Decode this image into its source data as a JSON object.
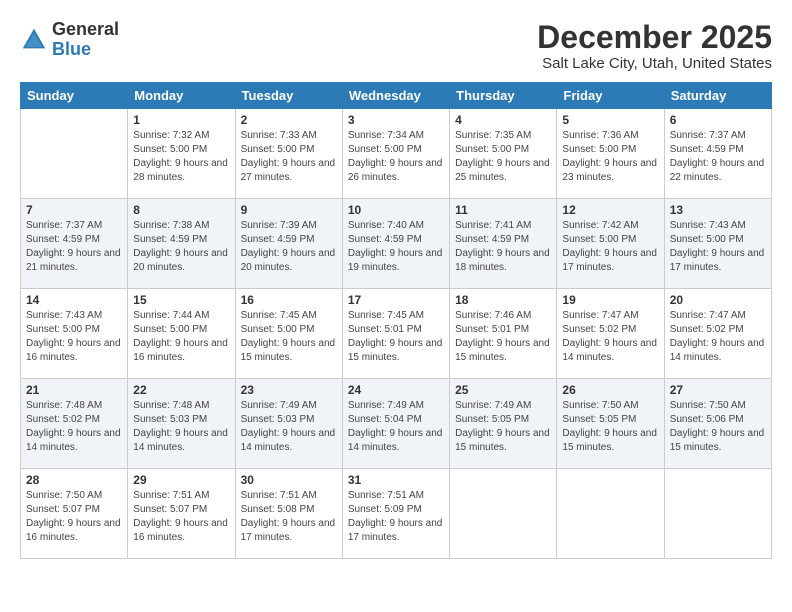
{
  "logo": {
    "general": "General",
    "blue": "Blue"
  },
  "title": "December 2025",
  "subtitle": "Salt Lake City, Utah, United States",
  "days_of_week": [
    "Sunday",
    "Monday",
    "Tuesday",
    "Wednesday",
    "Thursday",
    "Friday",
    "Saturday"
  ],
  "weeks": [
    [
      {
        "day": "",
        "sunrise": "",
        "sunset": "",
        "daylight": ""
      },
      {
        "day": "1",
        "sunrise": "Sunrise: 7:32 AM",
        "sunset": "Sunset: 5:00 PM",
        "daylight": "Daylight: 9 hours and 28 minutes."
      },
      {
        "day": "2",
        "sunrise": "Sunrise: 7:33 AM",
        "sunset": "Sunset: 5:00 PM",
        "daylight": "Daylight: 9 hours and 27 minutes."
      },
      {
        "day": "3",
        "sunrise": "Sunrise: 7:34 AM",
        "sunset": "Sunset: 5:00 PM",
        "daylight": "Daylight: 9 hours and 26 minutes."
      },
      {
        "day": "4",
        "sunrise": "Sunrise: 7:35 AM",
        "sunset": "Sunset: 5:00 PM",
        "daylight": "Daylight: 9 hours and 25 minutes."
      },
      {
        "day": "5",
        "sunrise": "Sunrise: 7:36 AM",
        "sunset": "Sunset: 5:00 PM",
        "daylight": "Daylight: 9 hours and 23 minutes."
      },
      {
        "day": "6",
        "sunrise": "Sunrise: 7:37 AM",
        "sunset": "Sunset: 4:59 PM",
        "daylight": "Daylight: 9 hours and 22 minutes."
      }
    ],
    [
      {
        "day": "7",
        "sunrise": "Sunrise: 7:37 AM",
        "sunset": "Sunset: 4:59 PM",
        "daylight": "Daylight: 9 hours and 21 minutes."
      },
      {
        "day": "8",
        "sunrise": "Sunrise: 7:38 AM",
        "sunset": "Sunset: 4:59 PM",
        "daylight": "Daylight: 9 hours and 20 minutes."
      },
      {
        "day": "9",
        "sunrise": "Sunrise: 7:39 AM",
        "sunset": "Sunset: 4:59 PM",
        "daylight": "Daylight: 9 hours and 20 minutes."
      },
      {
        "day": "10",
        "sunrise": "Sunrise: 7:40 AM",
        "sunset": "Sunset: 4:59 PM",
        "daylight": "Daylight: 9 hours and 19 minutes."
      },
      {
        "day": "11",
        "sunrise": "Sunrise: 7:41 AM",
        "sunset": "Sunset: 4:59 PM",
        "daylight": "Daylight: 9 hours and 18 minutes."
      },
      {
        "day": "12",
        "sunrise": "Sunrise: 7:42 AM",
        "sunset": "Sunset: 5:00 PM",
        "daylight": "Daylight: 9 hours and 17 minutes."
      },
      {
        "day": "13",
        "sunrise": "Sunrise: 7:43 AM",
        "sunset": "Sunset: 5:00 PM",
        "daylight": "Daylight: 9 hours and 17 minutes."
      }
    ],
    [
      {
        "day": "14",
        "sunrise": "Sunrise: 7:43 AM",
        "sunset": "Sunset: 5:00 PM",
        "daylight": "Daylight: 9 hours and 16 minutes."
      },
      {
        "day": "15",
        "sunrise": "Sunrise: 7:44 AM",
        "sunset": "Sunset: 5:00 PM",
        "daylight": "Daylight: 9 hours and 16 minutes."
      },
      {
        "day": "16",
        "sunrise": "Sunrise: 7:45 AM",
        "sunset": "Sunset: 5:00 PM",
        "daylight": "Daylight: 9 hours and 15 minutes."
      },
      {
        "day": "17",
        "sunrise": "Sunrise: 7:45 AM",
        "sunset": "Sunset: 5:01 PM",
        "daylight": "Daylight: 9 hours and 15 minutes."
      },
      {
        "day": "18",
        "sunrise": "Sunrise: 7:46 AM",
        "sunset": "Sunset: 5:01 PM",
        "daylight": "Daylight: 9 hours and 15 minutes."
      },
      {
        "day": "19",
        "sunrise": "Sunrise: 7:47 AM",
        "sunset": "Sunset: 5:02 PM",
        "daylight": "Daylight: 9 hours and 14 minutes."
      },
      {
        "day": "20",
        "sunrise": "Sunrise: 7:47 AM",
        "sunset": "Sunset: 5:02 PM",
        "daylight": "Daylight: 9 hours and 14 minutes."
      }
    ],
    [
      {
        "day": "21",
        "sunrise": "Sunrise: 7:48 AM",
        "sunset": "Sunset: 5:02 PM",
        "daylight": "Daylight: 9 hours and 14 minutes."
      },
      {
        "day": "22",
        "sunrise": "Sunrise: 7:48 AM",
        "sunset": "Sunset: 5:03 PM",
        "daylight": "Daylight: 9 hours and 14 minutes."
      },
      {
        "day": "23",
        "sunrise": "Sunrise: 7:49 AM",
        "sunset": "Sunset: 5:03 PM",
        "daylight": "Daylight: 9 hours and 14 minutes."
      },
      {
        "day": "24",
        "sunrise": "Sunrise: 7:49 AM",
        "sunset": "Sunset: 5:04 PM",
        "daylight": "Daylight: 9 hours and 14 minutes."
      },
      {
        "day": "25",
        "sunrise": "Sunrise: 7:49 AM",
        "sunset": "Sunset: 5:05 PM",
        "daylight": "Daylight: 9 hours and 15 minutes."
      },
      {
        "day": "26",
        "sunrise": "Sunrise: 7:50 AM",
        "sunset": "Sunset: 5:05 PM",
        "daylight": "Daylight: 9 hours and 15 minutes."
      },
      {
        "day": "27",
        "sunrise": "Sunrise: 7:50 AM",
        "sunset": "Sunset: 5:06 PM",
        "daylight": "Daylight: 9 hours and 15 minutes."
      }
    ],
    [
      {
        "day": "28",
        "sunrise": "Sunrise: 7:50 AM",
        "sunset": "Sunset: 5:07 PM",
        "daylight": "Daylight: 9 hours and 16 minutes."
      },
      {
        "day": "29",
        "sunrise": "Sunrise: 7:51 AM",
        "sunset": "Sunset: 5:07 PM",
        "daylight": "Daylight: 9 hours and 16 minutes."
      },
      {
        "day": "30",
        "sunrise": "Sunrise: 7:51 AM",
        "sunset": "Sunset: 5:08 PM",
        "daylight": "Daylight: 9 hours and 17 minutes."
      },
      {
        "day": "31",
        "sunrise": "Sunrise: 7:51 AM",
        "sunset": "Sunset: 5:09 PM",
        "daylight": "Daylight: 9 hours and 17 minutes."
      },
      {
        "day": "",
        "sunrise": "",
        "sunset": "",
        "daylight": ""
      },
      {
        "day": "",
        "sunrise": "",
        "sunset": "",
        "daylight": ""
      },
      {
        "day": "",
        "sunrise": "",
        "sunset": "",
        "daylight": ""
      }
    ]
  ]
}
